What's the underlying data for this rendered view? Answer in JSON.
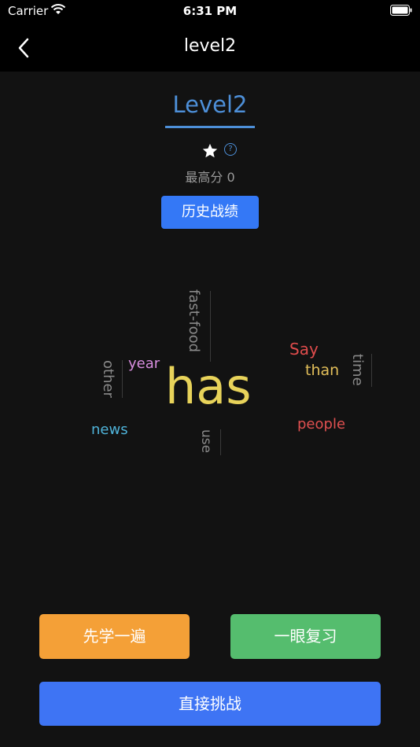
{
  "status_bar": {
    "carrier": "Carrier",
    "time": "6:31 PM"
  },
  "nav": {
    "title": "level2"
  },
  "level": {
    "title": "Level2",
    "help_symbol": "?",
    "best_score_label": "最高分 0"
  },
  "history_button": "历史战绩",
  "word_cloud": {
    "words": [
      {
        "text": "has",
        "color": "#e8d35a",
        "vertical": false
      },
      {
        "text": "fast-food",
        "color": "#8a8a8a",
        "vertical": true
      },
      {
        "text": "other",
        "color": "#8a8a8a",
        "vertical": true
      },
      {
        "text": "year",
        "color": "#d98ee0",
        "vertical": false
      },
      {
        "text": "Say",
        "color": "#e04c4c",
        "vertical": false
      },
      {
        "text": "than",
        "color": "#e3bf5a",
        "vertical": false
      },
      {
        "text": "time",
        "color": "#8a8a8a",
        "vertical": true
      },
      {
        "text": "news",
        "color": "#4fb3d9",
        "vertical": false
      },
      {
        "text": "use",
        "color": "#8a8a8a",
        "vertical": true
      },
      {
        "text": "people",
        "color": "#e05050",
        "vertical": false
      }
    ]
  },
  "buttons": {
    "learn": "先学一遍",
    "review": "一眼复习",
    "challenge": "直接挑战"
  },
  "colors": {
    "accent_blue": "#4d8fd8",
    "history_blue": "#3478f6",
    "learn_orange": "#f4a037",
    "review_green": "#55bd6e",
    "challenge_blue": "#3e74f4"
  }
}
